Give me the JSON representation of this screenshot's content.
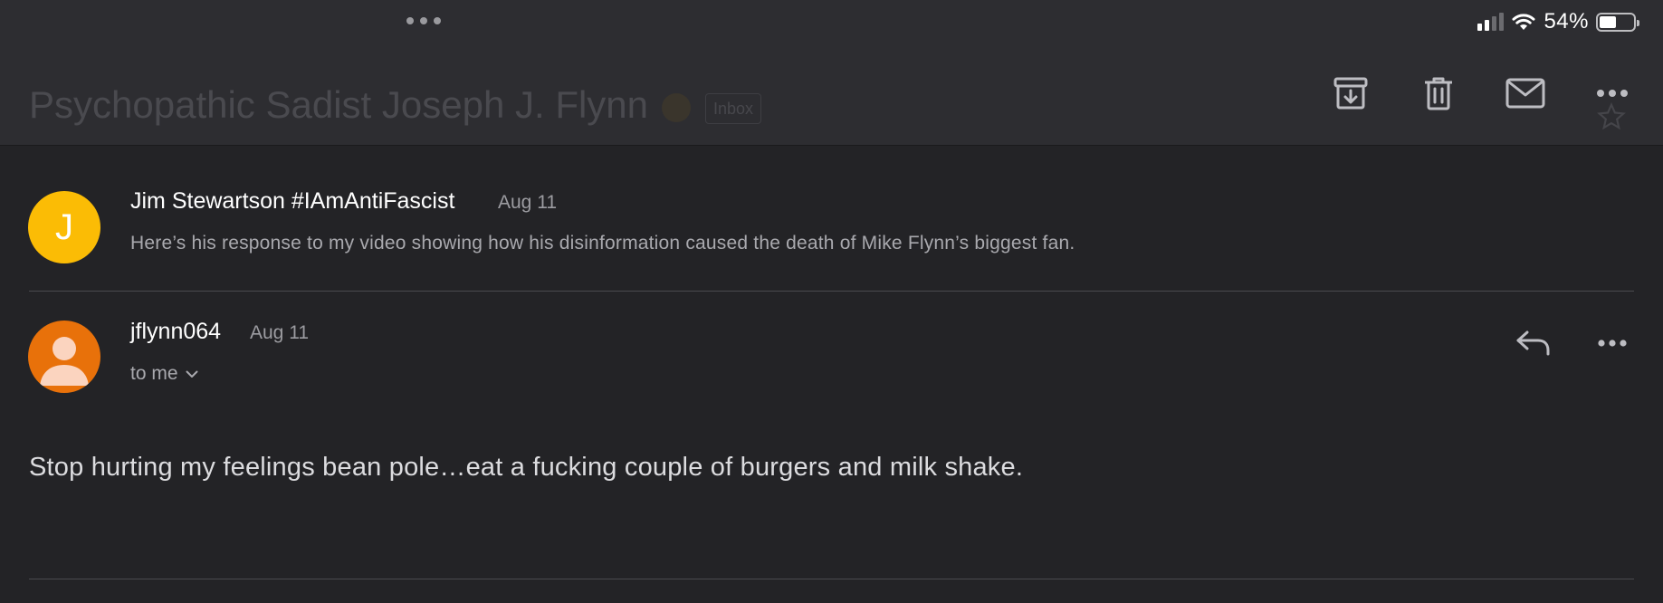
{
  "status_bar": {
    "battery_percent": "54%",
    "battery_level": 0.54
  },
  "header": {
    "subject": "Psychopathic Sadist Joseph J. Flynn",
    "label": "Inbox",
    "actions": [
      {
        "name": "archive-icon"
      },
      {
        "name": "trash-icon"
      },
      {
        "name": "mail-icon"
      },
      {
        "name": "more-icon"
      }
    ]
  },
  "messages": [
    {
      "avatar_letter": "J",
      "avatar_color": "#fbbc05",
      "sender": "Jim Stewartson #IAmAntiFascist",
      "date": "Aug 11",
      "snippet": "Here’s his response to my video showing how his disinformation caused the death of Mike Flynn’s biggest fan."
    },
    {
      "avatar_color": "#e8710a",
      "sender": "jflynn064",
      "date": "Aug 11",
      "recipient": "to me",
      "body": "Stop hurting my feelings bean pole…eat a fucking couple of burgers and milk shake."
    }
  ],
  "colors": {
    "background": "#232326",
    "topbar": "#2d2d31"
  }
}
